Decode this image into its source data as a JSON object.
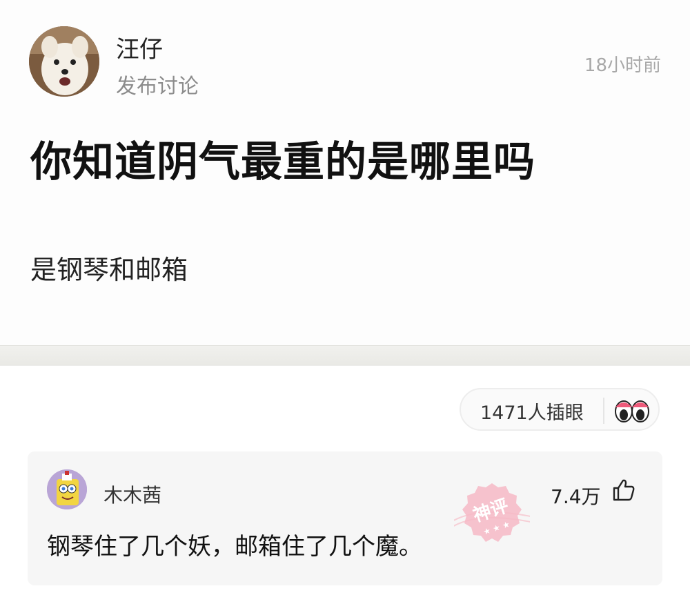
{
  "post": {
    "author_name": "汪仔",
    "author_action": "发布讨论",
    "time": "18小时前",
    "title": "你知道阴气最重的是哪里吗",
    "body": "是钢琴和邮箱"
  },
  "reactions": {
    "peek_label": "1471人插眼",
    "peek_icon": "eyes-icon"
  },
  "top_comment": {
    "user_name": "木木茜",
    "likes": "7.4万",
    "like_icon": "thumbs-up-icon",
    "text": "钢琴住了几个妖，邮箱住了几个魔。",
    "badge_text": "神评",
    "badge_color": "#f2a6b4"
  }
}
